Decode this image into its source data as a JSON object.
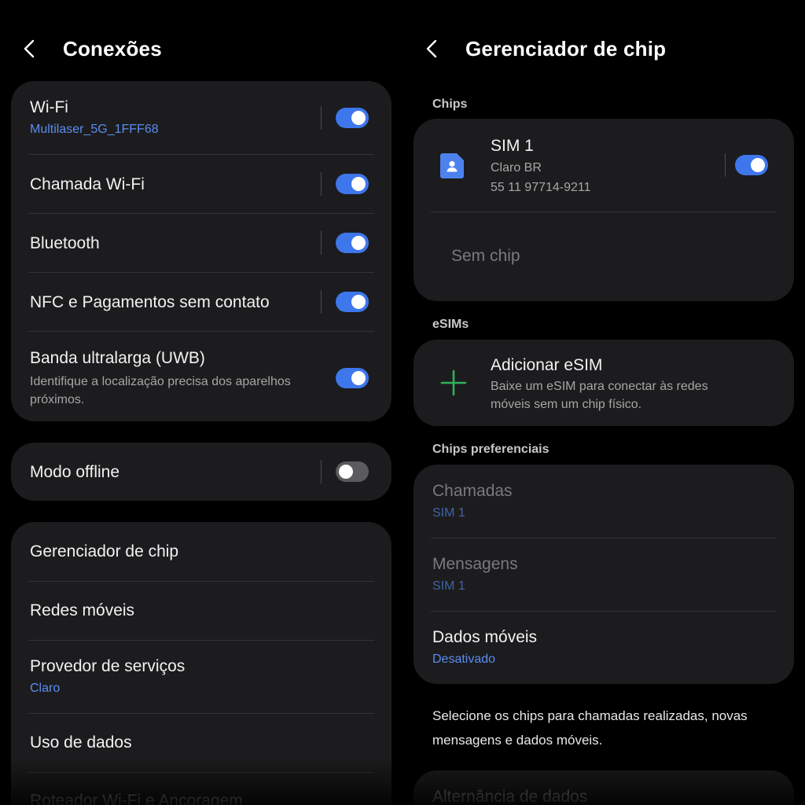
{
  "left": {
    "title": "Conexões",
    "group1": {
      "wifi": {
        "label": "Wi-Fi",
        "network": "Multilaser_5G_1FFF68",
        "enabled": true
      },
      "wifi_call": {
        "label": "Chamada Wi-Fi",
        "enabled": true
      },
      "bluetooth": {
        "label": "Bluetooth",
        "enabled": true
      },
      "nfc": {
        "label": "NFC e Pagamentos sem contato",
        "enabled": true
      },
      "uwb": {
        "label": "Banda ultralarga (UWB)",
        "description": "Identifique a localização precisa dos aparelhos próximos.",
        "enabled": true
      }
    },
    "offline": {
      "label": "Modo offline",
      "enabled": false
    },
    "group3": {
      "sim_manager": {
        "label": "Gerenciador de chip"
      },
      "mobile_networks": {
        "label": "Redes móveis"
      },
      "service_provider": {
        "label": "Provedor de serviços",
        "value": "Claro"
      },
      "data_usage": {
        "label": "Uso de dados"
      },
      "hotspot": {
        "label": "Roteador Wi-Fi e Ancoragem"
      }
    }
  },
  "right": {
    "title": "Gerenciador de chip",
    "chips_section": "Chips",
    "sim1": {
      "name": "SIM 1",
      "carrier": "Claro BR",
      "number": "55 11 97714-9211",
      "enabled": true
    },
    "no_chip": "Sem chip",
    "esims_section": "eSIMs",
    "add_esim": {
      "label": "Adicionar eSIM",
      "description": "Baixe um eSIM para conectar às redes móveis sem um chip físico."
    },
    "preferred_section": "Chips preferenciais",
    "calls": {
      "label": "Chamadas",
      "value": "SIM 1"
    },
    "messages": {
      "label": "Mensagens",
      "value": "SIM 1"
    },
    "mobile_data": {
      "label": "Dados móveis",
      "value": "Desativado"
    },
    "footnote": "Selecione os chips para chamadas realizadas, novas mensagens e dados móveis.",
    "data_switch": {
      "label": "Alternância de dados"
    }
  },
  "colors": {
    "background": "#000000",
    "card": "#1c1c1e",
    "accent": "#3e76ec",
    "link_blue": "#5a8df0",
    "plus_green": "#2fb15a"
  },
  "icons": [
    "back-arrow-icon",
    "sim-card-icon",
    "plus-icon"
  ]
}
